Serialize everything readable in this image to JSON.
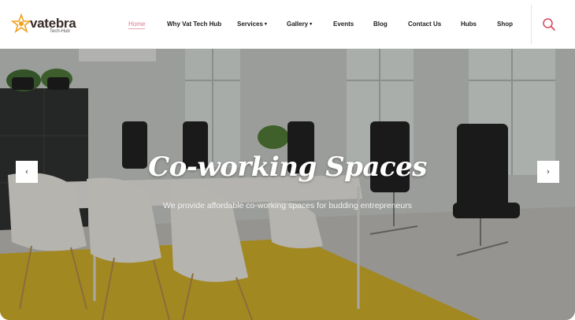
{
  "brand": {
    "name": "vatebra",
    "tagline": "Tech-Hub",
    "colors": {
      "accent": "#d9798f",
      "search": "#d9435a",
      "logo_orange": "#f0a11f"
    }
  },
  "nav": {
    "items": [
      {
        "label": "Home",
        "active": true,
        "has_dropdown": false
      },
      {
        "label": "Why Vat Tech Hub",
        "active": false,
        "has_dropdown": false
      },
      {
        "label": "Services",
        "active": false,
        "has_dropdown": true
      },
      {
        "label": "Gallery",
        "active": false,
        "has_dropdown": true
      },
      {
        "label": "Events",
        "active": false,
        "has_dropdown": false
      },
      {
        "label": "Blog",
        "active": false,
        "has_dropdown": false
      },
      {
        "label": "Contact Us",
        "active": false,
        "has_dropdown": false
      },
      {
        "label": "Hubs",
        "active": false,
        "has_dropdown": false
      },
      {
        "label": "Shop",
        "active": false,
        "has_dropdown": false
      }
    ],
    "caret": "▾",
    "search_icon": "search-icon"
  },
  "hero": {
    "title": "Co-working Spaces",
    "subtitle": "We provide affordable co-working spaces for budding entrepreneurs",
    "prev_arrow": "‹",
    "next_arrow": "›"
  }
}
